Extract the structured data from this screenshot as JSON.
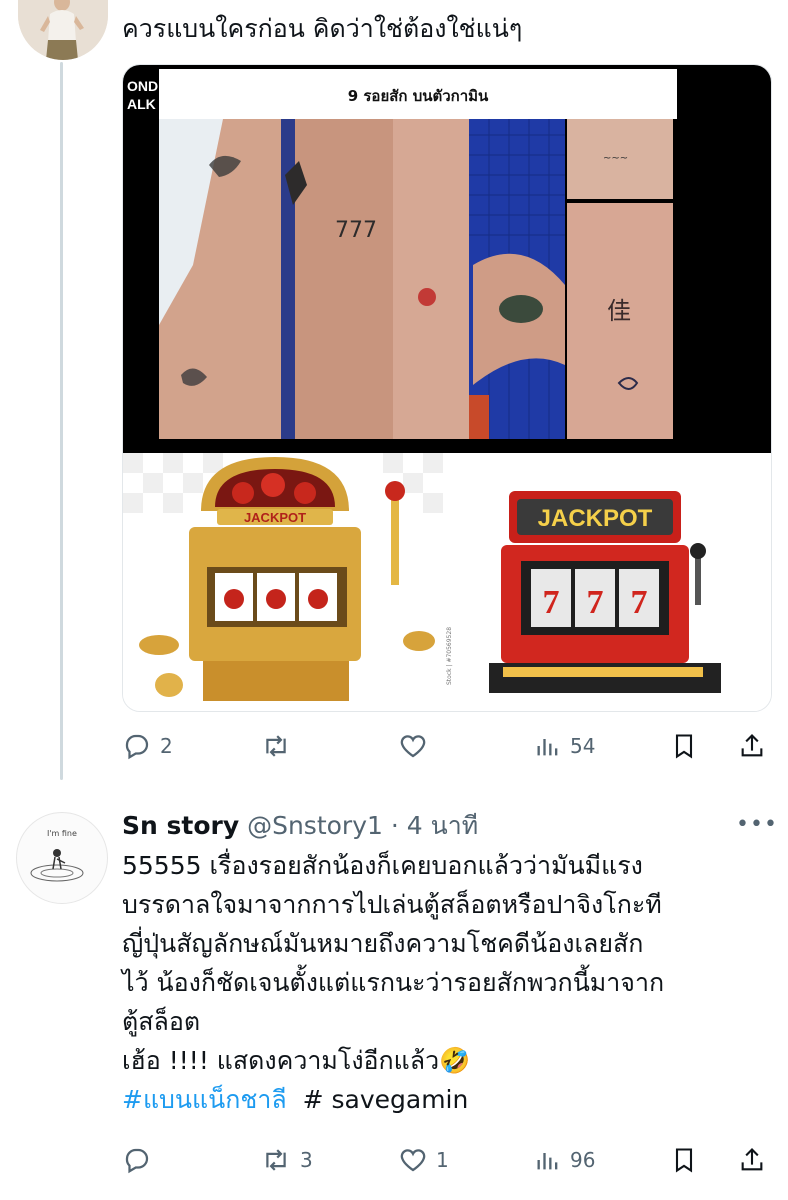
{
  "top_tweet": {
    "text": "ควรแบนใครก่อน คิดว่าใช่ต้องใช่แน่ๆ",
    "media": {
      "brand_corner": "ONDH\nALK",
      "caption": "9 รอยสัก บนตัวกามิน",
      "jackpot_left": "JACKPOT",
      "jackpot_right": "JACKPOT",
      "reels": "777",
      "stock_watermark": "Stock | #70569528"
    },
    "actions": {
      "replies": "2",
      "reposts": "",
      "likes": "",
      "views": "54"
    }
  },
  "reply_tweet": {
    "avatar_text": "I'm fine",
    "display_name": "Sn story",
    "handle": "@Snstory1",
    "separator": "·",
    "time": "4 นาที",
    "lines": [
      "55555 เรื่องรอยสักน้องก็เคยบอกแล้วว่ามันมีแรง",
      "บรรดาลใจมาจากการไปเล่นตู้สล็อตหรือปาจิงโกะที",
      "ญี่ปุ่นสัญลักษณ์มันหมายถึงความโชคดีน้องเลยสัก",
      "ไว้ น้องก็ชัดเจนตั้งแต่แรกนะว่ารอยสักพวกนี้มาจาก",
      "ตู้สล็อต",
      "เฮ้อ !!!! แสดงความโง่อีกแล้ว🤣"
    ],
    "hashtag": "#แบนแน็กชาลี",
    "hashtag_plain": "# savegamin",
    "actions": {
      "replies": "",
      "reposts": "3",
      "likes": "1",
      "views": "96"
    }
  },
  "colors": {
    "muted": "#536471",
    "link": "#1d9bf0",
    "line": "#cfd9de"
  }
}
